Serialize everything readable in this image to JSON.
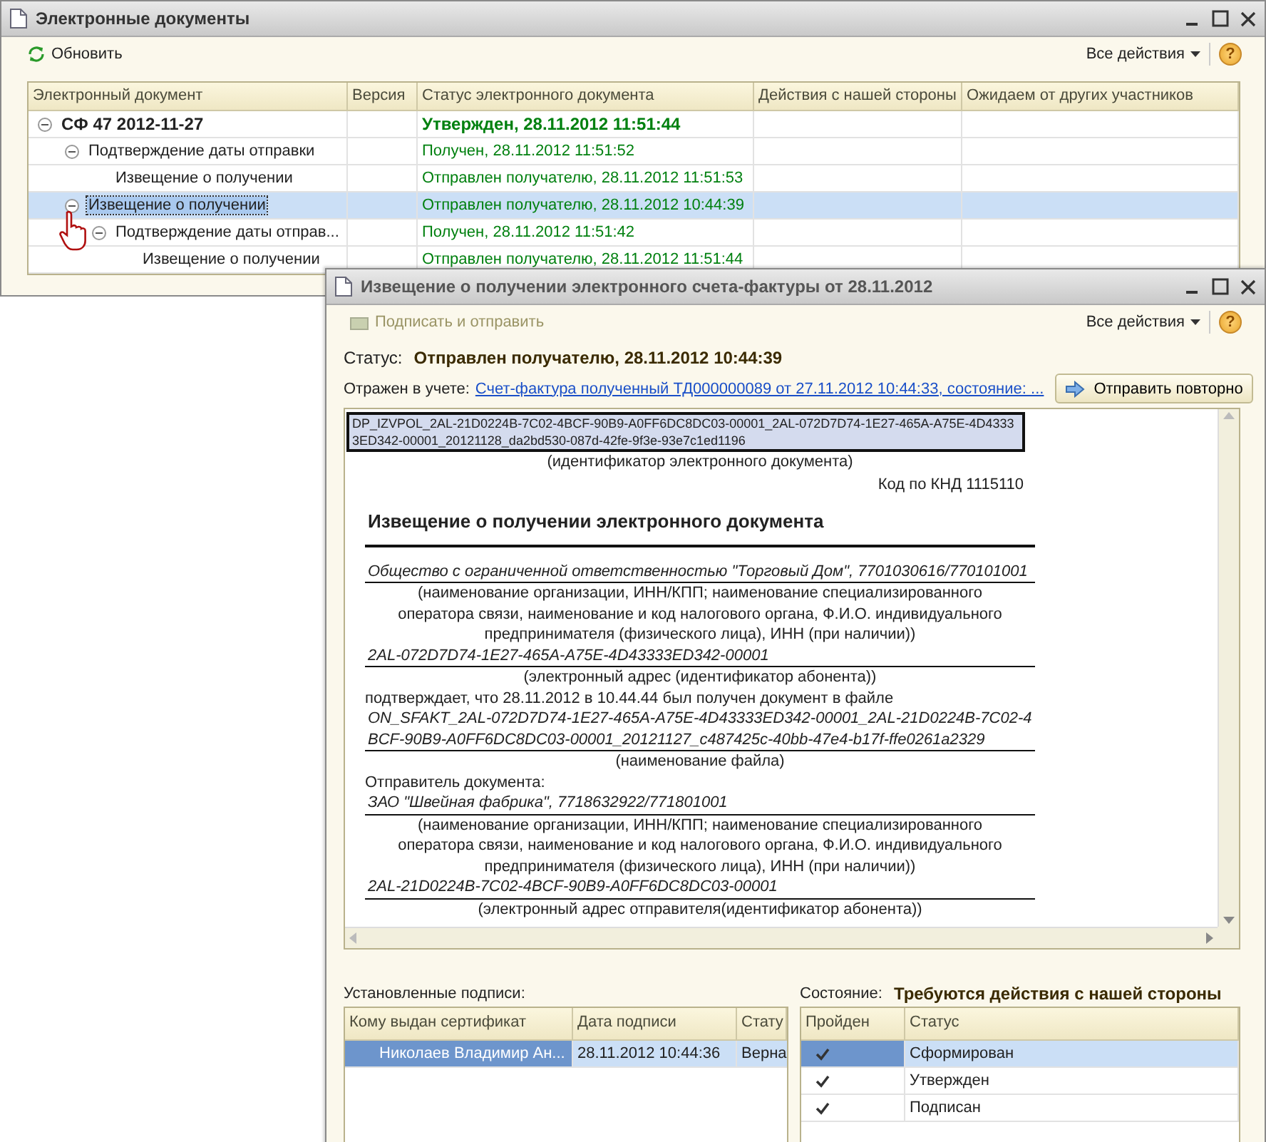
{
  "main_window": {
    "title": "Электронные документы",
    "refresh_button": "Обновить",
    "all_actions": "Все действия",
    "help": "?",
    "columns": [
      "Электронный документ",
      "Версия",
      "Статус электронного документа",
      "Действия с нашей стороны",
      "Ожидаем от других участников"
    ],
    "rows": [
      {
        "kind": "document",
        "label": "СФ 47 2012-11-27",
        "status": "Утвержден, 28.11.2012 11:51:44",
        "expanded": true,
        "selected": false,
        "children": [
          {
            "kind": "message",
            "label": "Подтверждение даты отправки",
            "status": "Получен, 28.11.2012 11:51:52",
            "expanded": true,
            "selected": false,
            "children": [
              {
                "kind": "message",
                "label": "Извещение о получении",
                "status": "Отправлен получателю, 28.11.2012 11:51:53",
                "selected": false
              }
            ]
          },
          {
            "kind": "message",
            "label": "Извещение о получении",
            "status": "Отправлен получателю, 28.11.2012 10:44:39",
            "expanded": true,
            "selected": true,
            "children": [
              {
                "kind": "message",
                "label": "Подтверждение даты отправ...",
                "status": "Получен, 28.11.2012 11:51:42",
                "expanded": true,
                "selected": false,
                "children": [
                  {
                    "kind": "message",
                    "label": "Извещение о получении",
                    "status": "Отправлен получателю, 28.11.2012 11:51:44",
                    "selected": false
                  }
                ]
              }
            ]
          }
        ]
      }
    ]
  },
  "dialog": {
    "title": "Извещение о получении электронного счета-фактуры от 28.11.2012",
    "sign_button": {
      "label": "Подписать и отправить",
      "disabled": true
    },
    "all_actions": "Все действия",
    "help": "?",
    "status_label": "Статус:",
    "status_value": "Отправлен получателю, 28.11.2012 10:44:39",
    "reflected_label": "Отражен в учете:",
    "reflected_link": "Счет-фактура полученный ТД000000089 от 27.11.2012 10:44:33, состояние: ...",
    "resend_button": "Отправить повторно",
    "document": [
      {
        "kind": "id",
        "text": "DP_IZVPOL_2AL-21D0224B-7C02-4BCF-90B9-A0FF6DC8DC03-00001_2AL-072D7D74-1E27-465A-A75E-4D43333ED342-00001_20121128_da2bd530-087d-42fe-9f3e-93e7c1ed1196"
      },
      {
        "kind": "caption",
        "text": "(идентификатор электронного документа)"
      },
      {
        "kind": "code",
        "text": "Код по КНД 1115110"
      },
      {
        "kind": "title",
        "text": "Извещение о получении электронного документа"
      },
      {
        "kind": "value",
        "text": "Общество с ограниченной ответственностью \"Торговый Дом\", 7701030616/770101001"
      },
      {
        "kind": "caption",
        "text": "(наименование организации, ИНН/КПП; наименование специализированного оператора связи, наименование и код налогового органа, Ф.И.О. индивидуального предпринимателя (физического лица), ИНН (при наличии))"
      },
      {
        "kind": "value",
        "text": "2AL-072D7D74-1E27-465A-A75E-4D43333ED342-00001"
      },
      {
        "kind": "caption",
        "text": "(электронный адрес (идентификатор абонента))"
      },
      {
        "kind": "text",
        "text": "подтверждает, что 28.11.2012 в 10.44.44 был получен документ в файле"
      },
      {
        "kind": "value",
        "text": "ON_SFAKT_2AL-072D7D74-1E27-465A-A75E-4D43333ED342-00001_2AL-21D0224B-7C02-4BCF-90B9-A0FF6DC8DC03-00001_20121127_c487425c-40bb-47e4-b17f-ffe0261a2329"
      },
      {
        "kind": "caption",
        "text": "(наименование файла)"
      },
      {
        "kind": "text",
        "text": "Отправитель документа:"
      },
      {
        "kind": "value",
        "text": "ЗАО \"Швейная фабрика\", 7718632922/771801001"
      },
      {
        "kind": "caption",
        "text": "(наименование организации, ИНН/КПП; наименование специализированного оператора связи, наименование и код налогового органа, Ф.И.О. индивидуального предпринимателя (физического лица), ИНН (при наличии))"
      },
      {
        "kind": "value",
        "text": "2AL-21D0224B-7C02-4BCF-90B9-A0FF6DC8DC03-00001"
      },
      {
        "kind": "caption",
        "text": "(электронный адрес отправителя(идентификатор абонента))"
      }
    ],
    "signatures": {
      "label": "Установленные подписи:",
      "columns": [
        "Кому выдан сертификат",
        "Дата подписи",
        "Стату"
      ],
      "rows": [
        {
          "cells": [
            "Николаев Владимир Ан...",
            "28.11.2012 10:44:36",
            "Верна"
          ],
          "selected": true
        }
      ]
    },
    "state": {
      "label": "Состояние:",
      "value": "Требуются действия с нашей стороны",
      "columns": [
        "Пройден",
        "Статус"
      ],
      "rows": [
        {
          "passed": true,
          "status": "Сформирован",
          "selected": true
        },
        {
          "passed": true,
          "status": "Утвержден",
          "selected": false
        },
        {
          "passed": true,
          "status": "Подписан",
          "selected": false
        }
      ]
    }
  }
}
